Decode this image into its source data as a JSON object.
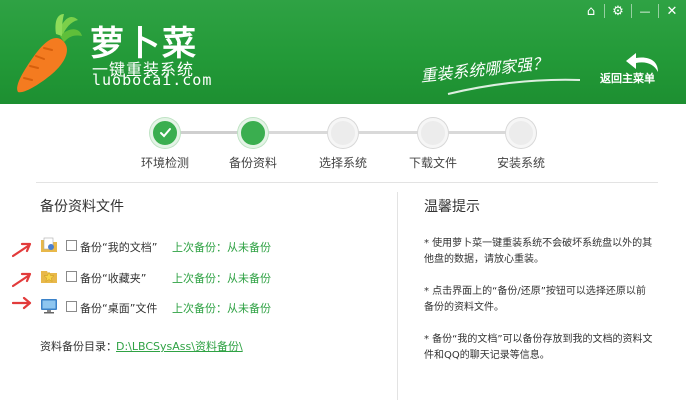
{
  "header": {
    "brand_title": "萝卜菜",
    "brand_subtitle": "一键重装系统",
    "brand_url": "luobocai.com",
    "slogan": "重装系统哪家强？",
    "back_label": "返回主菜单"
  },
  "window_controls": {
    "home": "⌂",
    "settings": "⚙",
    "minimize": "—",
    "close": "✕"
  },
  "steps": [
    {
      "label": "环境检测",
      "state": "done"
    },
    {
      "label": "备份资料",
      "state": "active"
    },
    {
      "label": "选择系统",
      "state": "pending"
    },
    {
      "label": "下载文件",
      "state": "pending"
    },
    {
      "label": "安装系统",
      "state": "pending"
    }
  ],
  "backup": {
    "title": "备份资料文件",
    "items": [
      {
        "label": "备份“我的文档”",
        "status": "上次备份：从未备份"
      },
      {
        "label": "备份“收藏夹”",
        "status": "上次备份：从未备份"
      },
      {
        "label": "备份“桌面”文件",
        "status": "上次备份：从未备份"
      }
    ],
    "dir_label": "资料备份目录：",
    "dir_path": "D:\\LBCSysAss\\资料备份\\"
  },
  "tips": {
    "title": "温馨提示",
    "items": [
      "* 使用萝卜菜一键重装系统不会破坏系统盘以外的其他盘的数据，请放心重装。",
      "* 点击界面上的“备份/还原”按钮可以选择还原以前备份的资料文件。",
      "* 备份“我的文档”可以备份存放到我的文档的资料文件和QQ的聊天记录等信息。"
    ]
  },
  "colors": {
    "brand_green": "#239a38",
    "accent_green": "#2fa244",
    "arrow_red": "#e23b3b"
  }
}
